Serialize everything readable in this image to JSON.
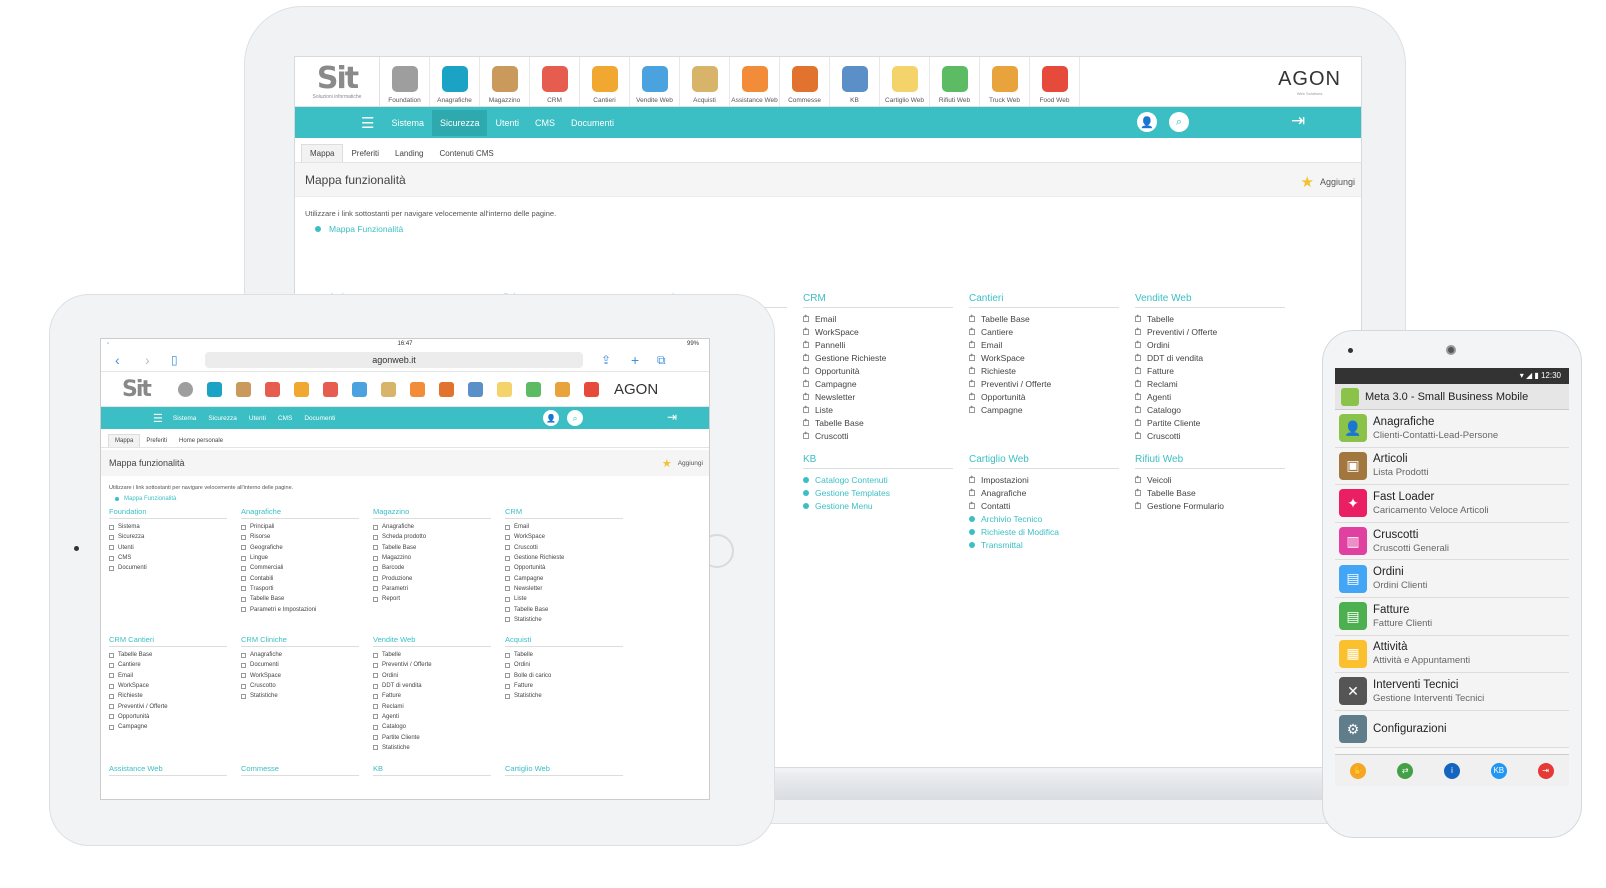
{
  "laptop": {
    "modules": [
      {
        "label": "Foundation",
        "color": "#9e9e9e"
      },
      {
        "label": "Anagrafiche",
        "color": "#1ba3c6"
      },
      {
        "label": "Magazzino",
        "color": "#c99a5b"
      },
      {
        "label": "CRM",
        "color": "#e65c4f"
      },
      {
        "label": "Cantieri",
        "color": "#f0a830"
      },
      {
        "label": "Vendite Web",
        "color": "#4aa3df"
      },
      {
        "label": "Acquisti",
        "color": "#d8b36a"
      },
      {
        "label": "Assistance Web",
        "color": "#f28c38"
      },
      {
        "label": "Commesse",
        "color": "#e2732f"
      },
      {
        "label": "KB",
        "color": "#5a8fc7"
      },
      {
        "label": "Cartiglio Web",
        "color": "#f5d36b"
      },
      {
        "label": "Rifiuti Web",
        "color": "#5dbb63"
      },
      {
        "label": "Truck Web",
        "color": "#e8a33c"
      },
      {
        "label": "Food Web",
        "color": "#e64a3b"
      }
    ],
    "agon": "AGON",
    "agon_sub": "Web Solutions",
    "nav": [
      "Sistema",
      "Sicurezza",
      "Utenti",
      "CMS",
      "Documenti"
    ],
    "tabs": [
      "Mappa",
      "Preferiti",
      "Landing",
      "Contenuti CMS"
    ],
    "page_title": "Mappa funzionalità",
    "add_label": "Aggiungi",
    "description": "Utilizzare i link sottostanti per navigare velocemente all'interno delle pagine.",
    "map_link": "Mappa Funzionalità",
    "sections": [
      {
        "title": "Foundation",
        "items": [
          "Sistema",
          "Sicurezza"
        ]
      },
      {
        "title": "Anagrafiche",
        "items": [
          "Principali",
          "Risorse"
        ]
      },
      {
        "title": "Magazzino",
        "items": [
          "Anagrafiche",
          "Scheda prodotto"
        ]
      },
      {
        "title": "CRM",
        "items": [
          "Email",
          "WorkSpace",
          "Pannelli",
          "Gestione Richieste",
          "Opportunità",
          "Campagne",
          "Newsletter",
          "Liste",
          "Tabelle Base",
          "Cruscotti"
        ]
      },
      {
        "title": "Cantieri",
        "items": [
          "Tabelle Base",
          "Cantiere",
          "Email",
          "WorkSpace",
          "Richieste",
          "Preventivi / Offerte",
          "Opportunità",
          "Campagne"
        ]
      },
      {
        "title": "Vendite Web",
        "items": [
          "Tabelle",
          "Preventivi / Offerte",
          "Ordini",
          "DDT di vendita",
          "Fatture",
          "Reclami",
          "Agenti",
          "Catalogo",
          "Partite Cliente",
          "Cruscotti"
        ]
      },
      {
        "title": "KB",
        "links": [
          "Catalogo Contenuti",
          "Gestione Templates",
          "Gestione Menu"
        ]
      },
      {
        "title": "Cartiglio Web",
        "items": [
          "Impostazioni",
          "Anagrafiche",
          "Contatti"
        ],
        "links": [
          "Archivio Tecnico",
          "Richieste di Modifica",
          "Transmittal"
        ]
      },
      {
        "title": "Rifiuti Web",
        "items": [
          "Veicoli",
          "Tabelle Base",
          "Gestione Formulario"
        ]
      }
    ]
  },
  "tablet": {
    "time": "16:47",
    "battery": "99%",
    "url": "agonweb.it",
    "icon_colors": [
      "#9e9e9e",
      "#1ba3c6",
      "#c99a5b",
      "#e65c4f",
      "#f0a830",
      "#e65c4f",
      "#4aa3df",
      "#d8b36a",
      "#f28c38",
      "#e2732f",
      "#5a8fc7",
      "#f5d36b",
      "#5dbb63",
      "#e8a33c",
      "#e64a3b"
    ],
    "agon": "AGON",
    "nav": [
      "Sistema",
      "Sicurezza",
      "Utenti",
      "CMS",
      "Documenti"
    ],
    "tabs": [
      "Mappa",
      "Preferiti",
      "Home personale"
    ],
    "page_title": "Mappa funzionalità",
    "add_label": "Aggiungi",
    "description": "Utilizzare i link sottostanti per navigare velocemente all'interno delle pagine.",
    "map_link": "Mappa Funzionalità",
    "sections": [
      {
        "title": "Foundation",
        "items": [
          "Sistema",
          "Sicurezza",
          "Utenti",
          "CMS",
          "Documenti"
        ]
      },
      {
        "title": "Anagrafiche",
        "items": [
          "Principali",
          "Risorse",
          "Geografiche",
          "Lingue",
          "Commerciali",
          "Contabili",
          "Trasporti",
          "Tabelle Base",
          "Parametri e Impostazioni"
        ]
      },
      {
        "title": "Magazzino",
        "items": [
          "Anagrafiche",
          "Scheda prodotto",
          "Tabelle Base",
          "Magazzino",
          "Barcode",
          "Produzione",
          "Parametri",
          "Report"
        ]
      },
      {
        "title": "CRM",
        "items": [
          "Email",
          "WorkSpace",
          "Cruscotti",
          "Gestione Richieste",
          "Opportunità",
          "Campagne",
          "Newsletter",
          "Liste",
          "Tabelle Base",
          "Statistiche"
        ]
      },
      {
        "title": "CRM Cantieri",
        "items": [
          "Tabelle Base",
          "Cantiere",
          "Email",
          "WorkSpace",
          "Richieste",
          "Preventivi / Offerte",
          "Opportunità",
          "Campagne"
        ]
      },
      {
        "title": "CRM Cliniche",
        "items": [
          "Anagrafiche",
          "Documenti",
          "WorkSpace",
          "Cruscotto",
          "Statistiche"
        ]
      },
      {
        "title": "Vendite Web",
        "items": [
          "Tabelle",
          "Preventivi / Offerte",
          "Ordini",
          "DDT di vendita",
          "Fatture",
          "Reclami",
          "Agenti",
          "Catalogo",
          "Partite Cliente",
          "Statistiche"
        ]
      },
      {
        "title": "Acquisti",
        "items": [
          "Tabelle",
          "Ordini",
          "Bolle di carico",
          "Fatture",
          "Statistiche"
        ]
      }
    ],
    "bottom_titles": [
      "Assistance Web",
      "Commesse",
      "KB",
      "Cartiglio Web"
    ]
  },
  "phone": {
    "time": "12:30",
    "header": "Meta 3.0 - Small Business Mobile",
    "rows": [
      {
        "title": "Anagrafiche",
        "sub": "Clienti-Contatti-Lead-Persone",
        "color": "#8bc34a",
        "icon": "person-icon"
      },
      {
        "title": "Articoli",
        "sub": "Lista Prodotti",
        "color": "#a1773f",
        "icon": "box-icon"
      },
      {
        "title": "Fast Loader",
        "sub": "Caricamento Veloce Articoli",
        "color": "#e91e63",
        "icon": "wand-icon"
      },
      {
        "title": "Cruscotti",
        "sub": "Cruscotti Generali",
        "color": "#e040a0",
        "icon": "chart-icon"
      },
      {
        "title": "Ordini",
        "sub": "Ordini Clienti",
        "color": "#42a5f5",
        "icon": "document-icon"
      },
      {
        "title": "Fatture",
        "sub": "Fatture Clienti",
        "color": "#4caf50",
        "icon": "invoice-icon"
      },
      {
        "title": "Attività",
        "sub": "Attività e Appuntamenti",
        "color": "#fbc02d",
        "icon": "calendar-icon"
      },
      {
        "title": "Interventi Tecnici",
        "sub": "Gestione Interventi Tecnici",
        "color": "#555555",
        "icon": "tools-icon"
      },
      {
        "title": "Configurazioni",
        "sub": "",
        "color": "#607d8b",
        "icon": "gear-icon"
      }
    ],
    "bottom": [
      {
        "name": "hand-icon",
        "color": "#f5a623",
        "glyph": "✋"
      },
      {
        "name": "sync-icon",
        "color": "#43a047",
        "glyph": "⇄"
      },
      {
        "name": "info-icon",
        "color": "#1565c0",
        "glyph": "i"
      },
      {
        "name": "kb-icon",
        "color": "#2196f3",
        "glyph": "KB"
      },
      {
        "name": "exit-icon",
        "color": "#e53935",
        "glyph": "⇥"
      }
    ]
  }
}
